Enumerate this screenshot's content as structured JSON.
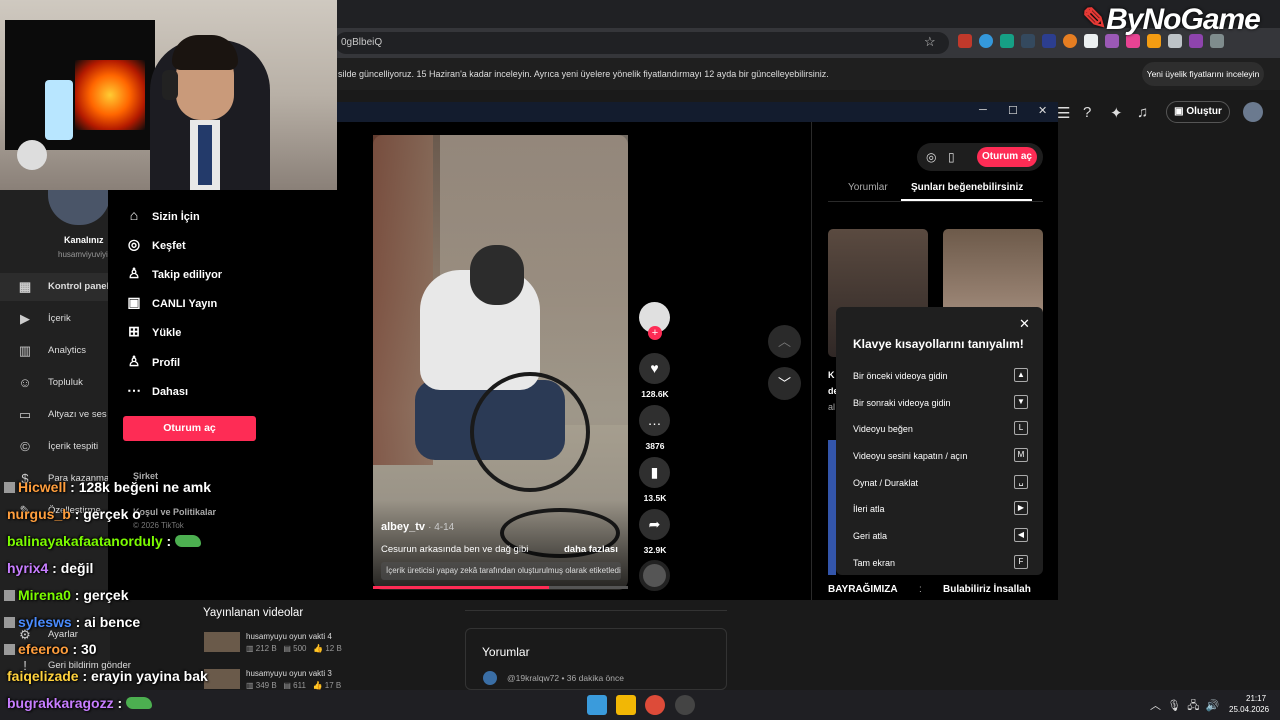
{
  "browser": {
    "url": "0gBlbeiQ",
    "brand_logo": "ByNoGame"
  },
  "notice": {
    "text": "silde güncelliyoruz. 15 Haziran'a kadar inceleyin. Ayrıca yeni üyelere yönelik fiyatlandırmayı 12 ayda bir güncelleyebilirsiniz.",
    "button": "Yeni üyelik fiyatlarını inceleyin"
  },
  "studio": {
    "create_label": "Oluştur",
    "channel_title": "Kanalınız",
    "channel_handle": "husamviyuviyi",
    "sidebar": [
      {
        "icon": "dashboard-icon",
        "glyph": "▦",
        "label": "Kontrol paneli"
      },
      {
        "icon": "content-icon",
        "glyph": "▶",
        "label": "İçerik"
      },
      {
        "icon": "analytics-icon",
        "glyph": "▥",
        "label": "Analytics"
      },
      {
        "icon": "community-icon",
        "glyph": "☺",
        "label": "Topluluk"
      },
      {
        "icon": "subtitles-icon",
        "glyph": "▭",
        "label": "Altyazı ve ses"
      },
      {
        "icon": "copyright-icon",
        "glyph": "©",
        "label": "İçerik tespiti"
      },
      {
        "icon": "earn-icon",
        "glyph": "$",
        "label": "Para kazanma"
      },
      {
        "icon": "customize-icon",
        "glyph": "✎",
        "label": "Özelleştirme"
      }
    ],
    "settings_label": "Ayarlar",
    "feedback_label": "Geri bildirim gönder",
    "published_title": "Yayınlanan videolar",
    "published": [
      {
        "name": "husamyuyu oyun vakti 4",
        "views": "212 B",
        "comments": "500",
        "likes": "12 B"
      },
      {
        "name": "husamyuyu oyun vakti 3",
        "views": "349 B",
        "comments": "611",
        "likes": "17 B"
      }
    ],
    "comments_card_title": "Yorumlar",
    "comment_user": "@19kralqw72 • 36 dakika önce"
  },
  "tiktok": {
    "nav": [
      {
        "icon": "home-icon",
        "glyph": "⌂",
        "label": "Sizin İçin"
      },
      {
        "icon": "compass-icon",
        "glyph": "◎",
        "label": "Keşfet"
      },
      {
        "icon": "following-icon",
        "glyph": "♙",
        "label": "Takip ediliyor"
      },
      {
        "icon": "live-icon",
        "glyph": "▣",
        "label": "CANLI Yayın"
      },
      {
        "icon": "upload-icon",
        "glyph": "⊞",
        "label": "Yükle"
      },
      {
        "icon": "profile-icon",
        "glyph": "♙",
        "label": "Profil"
      },
      {
        "icon": "more-icon",
        "glyph": "⋯",
        "label": "Dahası"
      }
    ],
    "login_button": "Oturum aç",
    "company": "Şirket",
    "terms": "Koşul ve Politikalar",
    "copyright": "© 2026 TikTok",
    "video": {
      "author": "albey_tv",
      "date": "· 4-14",
      "description": "Cesurun arkasında ben ve dağ gibi",
      "more": "daha fazlası",
      "ai_label": "İçerik üreticisi yapay zekâ tarafından oluşturulmuş olarak etiketledi",
      "progress": 0.69
    },
    "actions": {
      "likes": "128.6K",
      "comments": "3876",
      "saves": "13.5K",
      "shares": "32.9K"
    },
    "right_panel": {
      "login_button": "Oturum aç",
      "tab_comments": "Yorumlar",
      "tab_suggested": "Şunları beğenebilirsiniz",
      "snippet1": "K",
      "snippet2": "de",
      "snippet3": "al",
      "bottom_title": "BAYRAĞIMIZA",
      "bottom_sep": ":",
      "bottom_right": "Bulabiliriz İnsallah"
    },
    "shortcuts": {
      "title": "Klavye kısayollarını tanıyalım!",
      "items": [
        {
          "label": "Bir önceki videoya gidin",
          "key": "▲"
        },
        {
          "label": "Bir sonraki videoya gidin",
          "key": "▼"
        },
        {
          "label": "Videoyu beğen",
          "key": "L"
        },
        {
          "label": "Videoyu sesini kapatın / açın",
          "key": "M"
        },
        {
          "label": "Oynat / Duraklat",
          "key": "␣"
        },
        {
          "label": "İleri atla",
          "key": "▶"
        },
        {
          "label": "Geri atla",
          "key": "◀"
        },
        {
          "label": "Tam ekran",
          "key": "F"
        }
      ]
    }
  },
  "chat": [
    {
      "user": "Hicwell",
      "color": "#ff9e3d",
      "text": " : 128k beğeni ne amk",
      "emote": false
    },
    {
      "user": "nurgus_b",
      "color": "#ff9e3d",
      "text": " : gerçek o",
      "emote": false
    },
    {
      "user": "balinayakafaatanorduly",
      "color": "#7cfc00",
      "text": " : ",
      "emote": true
    },
    {
      "user": "hyrix4",
      "color": "#c77dff",
      "text": " : değil",
      "emote": false
    },
    {
      "user": "Mirena0",
      "color": "#7cfc00",
      "text": " : gerçek",
      "emote": false
    },
    {
      "user": "sylesws",
      "color": "#4a8cff",
      "text": " : ai bence",
      "emote": false
    },
    {
      "user": "efeeroo",
      "color": "#ff9e3d",
      "text": " : 30",
      "emote": false
    },
    {
      "user": "faiqelizade",
      "color": "#ffd23d",
      "text": " : erayin yayina bak",
      "emote": false
    },
    {
      "user": "bugrakkaragozz",
      "color": "#c77dff",
      "text": " : ",
      "emote": true
    }
  ],
  "taskbar": {
    "time": "21:17",
    "date": "25.04.2026"
  },
  "colors": {
    "tiktok_red": "#fe2c55"
  }
}
